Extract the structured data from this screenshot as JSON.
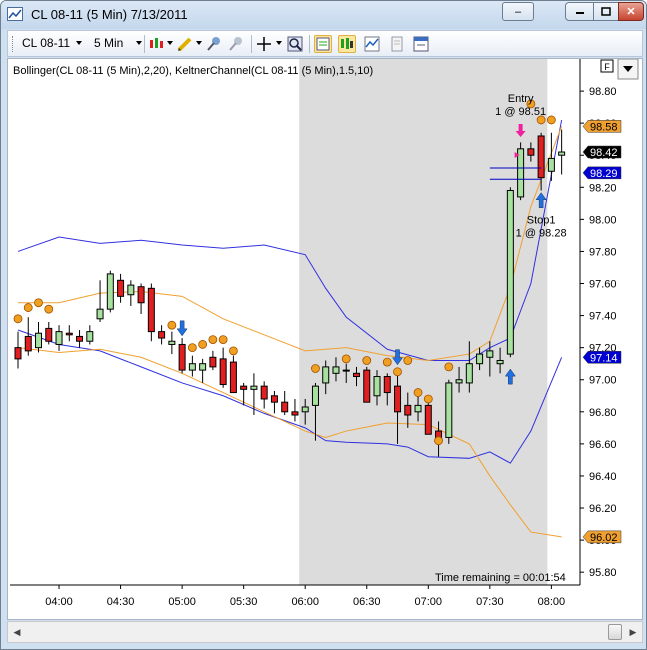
{
  "window": {
    "title": "CL 08-11 (5 Min)  7/13/2011",
    "buttons": {
      "minimize": "–",
      "maximize": "□",
      "close": "✕"
    }
  },
  "toolbar": {
    "instrument": "CL 08-11",
    "interval": "5 Min",
    "icons": [
      "chart-style-icon",
      "pencil-icon",
      "pin-icon",
      "pin-disabled-icon",
      "crosshair-icon",
      "zoom-icon",
      "data-box-icon",
      "chart-trader-icon",
      "indicators-icon",
      "strategies-icon",
      "properties-icon"
    ]
  },
  "chart": {
    "indicator_label": "Bollinger(CL 08-11 (5 Min),2,20), KeltnerChannel(CL 08-11 (5 Min),1.5,10)",
    "time_remaining": "Time remaining = 00:01:54",
    "corner_button": "F",
    "entry_label": "Entry",
    "entry_detail": "1 @ 98.51",
    "stop_label": "Stop1",
    "stop_detail": "1 @ 98.28",
    "highlight_start": "06:00",
    "highlight_end": "08:00"
  },
  "colors": {
    "up_candle": "#a8e0a0",
    "down_candle": "#e02020",
    "bollinger": "#3030e0",
    "keltner": "#f0a030",
    "session_shade": "#dcdcdc",
    "signal_dot": "#f0a020",
    "buy_arrow": "#2070e0",
    "entry_arrow": "#f020a0"
  },
  "chart_data": {
    "type": "candlestick",
    "x_axis_labels": [
      "04:00",
      "04:30",
      "05:00",
      "05:30",
      "06:00",
      "06:30",
      "07:00",
      "07:30",
      "08:00"
    ],
    "y_axis_labels": [
      "98.80",
      "98.60",
      "98.40",
      "98.20",
      "98.00",
      "97.80",
      "97.60",
      "97.40",
      "97.20",
      "97.00",
      "96.80",
      "96.60",
      "96.40",
      "96.20",
      "96.00",
      "95.80"
    ],
    "ylim": [
      95.72,
      99.0
    ],
    "xlim": [
      "03:40",
      "08:12"
    ],
    "price_markers": [
      {
        "label": "98.58",
        "value": 98.58,
        "color": "#f0a030",
        "text_color": "#000000"
      },
      {
        "label": "98.42",
        "value": 98.42,
        "color": "#000000",
        "text_color": "#ffffff"
      },
      {
        "label": "98.29",
        "value": 98.29,
        "color": "#0000d0",
        "text_color": "#ffffff"
      },
      {
        "label": "97.14",
        "value": 97.14,
        "color": "#0000d0",
        "text_color": "#ffffff"
      },
      {
        "label": "96.02",
        "value": 96.02,
        "color": "#f0a030",
        "text_color": "#000000"
      }
    ],
    "candles": [
      [
        "03:40",
        97.2,
        97.3,
        97.07,
        97.13
      ],
      [
        "03:45",
        97.27,
        97.39,
        97.15,
        97.18
      ],
      [
        "03:50",
        97.2,
        97.36,
        97.17,
        97.29
      ],
      [
        "03:55",
        97.32,
        97.36,
        97.22,
        97.24
      ],
      [
        "04:00",
        97.22,
        97.34,
        97.18,
        97.3
      ],
      [
        "04:05",
        97.29,
        97.34,
        97.24,
        97.28
      ],
      [
        "04:10",
        97.27,
        97.31,
        97.2,
        97.24
      ],
      [
        "04:15",
        97.24,
        97.34,
        97.22,
        97.3
      ],
      [
        "04:20",
        97.38,
        97.62,
        97.36,
        97.44
      ],
      [
        "04:25",
        97.44,
        97.68,
        97.42,
        97.66
      ],
      [
        "04:30",
        97.62,
        97.66,
        97.48,
        97.52
      ],
      [
        "04:35",
        97.53,
        97.62,
        97.46,
        97.59
      ],
      [
        "04:40",
        97.58,
        97.6,
        97.41,
        97.48
      ],
      [
        "04:45",
        97.57,
        97.6,
        97.24,
        97.3
      ],
      [
        "04:50",
        97.3,
        97.34,
        97.22,
        97.26
      ],
      [
        "04:55",
        97.22,
        97.3,
        97.16,
        97.24
      ],
      [
        "05:00",
        97.22,
        97.26,
        97.04,
        97.06
      ],
      [
        "05:05",
        97.06,
        97.15,
        97.02,
        97.1
      ],
      [
        "05:10",
        97.06,
        97.13,
        96.98,
        97.1
      ],
      [
        "05:15",
        97.14,
        97.18,
        97.06,
        97.08
      ],
      [
        "05:20",
        97.13,
        97.2,
        96.95,
        96.97
      ],
      [
        "05:25",
        97.11,
        97.15,
        96.92,
        96.92
      ],
      [
        "05:30",
        96.96,
        96.98,
        96.84,
        96.94
      ],
      [
        "05:35",
        96.94,
        97.04,
        96.78,
        96.96
      ],
      [
        "05:40",
        96.96,
        96.99,
        96.82,
        96.88
      ],
      [
        "05:45",
        96.9,
        96.93,
        96.79,
        96.86
      ],
      [
        "05:50",
        96.86,
        96.93,
        96.78,
        96.8
      ],
      [
        "05:55",
        96.8,
        96.88,
        96.74,
        96.78
      ],
      [
        "06:00",
        96.8,
        96.88,
        96.72,
        96.83
      ],
      [
        "06:05",
        96.84,
        96.98,
        96.62,
        96.96
      ],
      [
        "06:10",
        96.98,
        97.12,
        96.91,
        97.08
      ],
      [
        "06:15",
        97.04,
        97.14,
        96.99,
        97.08
      ],
      [
        "06:20",
        97.06,
        97.1,
        96.98,
        97.06
      ],
      [
        "06:25",
        97.04,
        97.08,
        96.96,
        97.02
      ],
      [
        "06:30",
        97.06,
        97.08,
        96.86,
        96.86
      ],
      [
        "06:35",
        96.9,
        97.06,
        96.84,
        97.02
      ],
      [
        "06:40",
        97.02,
        97.04,
        96.84,
        96.92
      ],
      [
        "06:45",
        96.96,
        97.04,
        96.6,
        96.8
      ],
      [
        "06:50",
        96.84,
        96.92,
        96.7,
        96.78
      ],
      [
        "06:55",
        96.8,
        96.9,
        96.74,
        96.84
      ],
      [
        "07:00",
        96.84,
        96.9,
        96.66,
        96.66
      ],
      [
        "07:05",
        96.68,
        96.74,
        96.52,
        96.62
      ],
      [
        "07:10",
        96.64,
        97.0,
        96.6,
        96.98
      ],
      [
        "07:15",
        96.98,
        97.08,
        96.92,
        97.0
      ],
      [
        "07:20",
        96.98,
        97.24,
        96.92,
        97.1
      ],
      [
        "07:25",
        97.1,
        97.2,
        97.06,
        97.16
      ],
      [
        "07:30",
        97.14,
        97.24,
        97.02,
        97.18
      ],
      [
        "07:35",
        97.1,
        97.2,
        97.04,
        97.12
      ],
      [
        "07:40",
        97.16,
        98.2,
        97.14,
        98.18
      ],
      [
        "07:45",
        98.14,
        98.48,
        98.12,
        98.44
      ],
      [
        "07:50",
        98.44,
        98.48,
        98.36,
        98.4
      ],
      [
        "07:55",
        98.52,
        98.54,
        98.18,
        98.26
      ],
      [
        "08:00",
        98.3,
        98.54,
        98.24,
        98.38
      ],
      [
        "08:05",
        98.4,
        98.56,
        98.28,
        98.42
      ]
    ],
    "bollinger_upper": [
      [
        "03:40",
        97.8
      ],
      [
        "04:00",
        97.89
      ],
      [
        "04:20",
        97.85
      ],
      [
        "04:40",
        97.87
      ],
      [
        "05:00",
        97.84
      ],
      [
        "05:20",
        97.82
      ],
      [
        "05:40",
        97.84
      ],
      [
        "06:00",
        97.78
      ],
      [
        "06:10",
        97.57
      ],
      [
        "06:20",
        97.39
      ],
      [
        "06:40",
        97.19
      ],
      [
        "07:00",
        97.12
      ],
      [
        "07:20",
        97.12
      ],
      [
        "07:30",
        97.2
      ],
      [
        "07:40",
        97.26
      ],
      [
        "07:50",
        97.6
      ],
      [
        "08:05",
        98.62
      ]
    ],
    "bollinger_lower": [
      [
        "03:40",
        97.31
      ],
      [
        "04:00",
        97.22
      ],
      [
        "04:20",
        97.18
      ],
      [
        "04:40",
        97.08
      ],
      [
        "05:00",
        96.98
      ],
      [
        "05:20",
        96.9
      ],
      [
        "05:40",
        96.79
      ],
      [
        "06:00",
        96.7
      ],
      [
        "06:10",
        96.62
      ],
      [
        "06:20",
        96.61
      ],
      [
        "06:40",
        96.6
      ],
      [
        "06:50",
        96.58
      ],
      [
        "07:00",
        96.52
      ],
      [
        "07:20",
        96.51
      ],
      [
        "07:30",
        96.55
      ],
      [
        "07:40",
        96.48
      ],
      [
        "07:50",
        96.68
      ],
      [
        "08:05",
        97.14
      ]
    ],
    "keltner_upper": [
      [
        "03:40",
        97.48
      ],
      [
        "04:00",
        97.48
      ],
      [
        "04:20",
        97.54
      ],
      [
        "04:40",
        97.55
      ],
      [
        "05:00",
        97.52
      ],
      [
        "05:20",
        97.38
      ],
      [
        "05:40",
        97.28
      ],
      [
        "06:00",
        97.18
      ],
      [
        "06:20",
        97.2
      ],
      [
        "06:40",
        97.15
      ],
      [
        "07:00",
        97.12
      ],
      [
        "07:20",
        97.16
      ],
      [
        "07:30",
        97.24
      ],
      [
        "07:40",
        97.58
      ],
      [
        "07:50",
        98.08
      ],
      [
        "08:05",
        98.58
      ]
    ],
    "keltner_lower": [
      [
        "03:40",
        97.2
      ],
      [
        "04:00",
        97.17
      ],
      [
        "04:20",
        97.19
      ],
      [
        "04:40",
        97.14
      ],
      [
        "05:00",
        97.04
      ],
      [
        "05:20",
        96.92
      ],
      [
        "05:40",
        96.8
      ],
      [
        "06:00",
        96.68
      ],
      [
        "06:10",
        96.64
      ],
      [
        "06:20",
        96.68
      ],
      [
        "06:40",
        96.73
      ],
      [
        "07:00",
        96.72
      ],
      [
        "07:20",
        96.6
      ],
      [
        "07:30",
        96.4
      ],
      [
        "07:40",
        96.22
      ],
      [
        "07:50",
        96.05
      ],
      [
        "08:05",
        96.02
      ]
    ],
    "signal_dots": [
      [
        "03:40",
        97.38
      ],
      [
        "03:45",
        97.45
      ],
      [
        "03:50",
        97.48
      ],
      [
        "03:55",
        97.44
      ],
      [
        "04:55",
        97.34
      ],
      [
        "05:05",
        97.2
      ],
      [
        "05:10",
        97.22
      ],
      [
        "05:15",
        97.25
      ],
      [
        "05:20",
        97.25
      ],
      [
        "05:25",
        97.18
      ],
      [
        "06:05",
        97.07
      ],
      [
        "06:20",
        97.13
      ],
      [
        "06:30",
        97.12
      ],
      [
        "06:40",
        97.11
      ],
      [
        "06:45",
        97.05
      ],
      [
        "06:50",
        97.12
      ],
      [
        "06:55",
        96.92
      ],
      [
        "07:00",
        96.88
      ],
      [
        "07:05",
        96.62
      ],
      [
        "07:10",
        97.08
      ],
      [
        "07:55",
        98.62
      ],
      [
        "08:00",
        98.62
      ],
      [
        "07:50",
        98.72
      ]
    ],
    "down_arrows": [
      [
        "05:00",
        97.28
      ],
      [
        "06:45",
        97.1
      ]
    ],
    "up_arrows": [
      [
        "07:40",
        97.06
      ],
      [
        "07:55",
        98.16
      ]
    ],
    "entry_arrow": [
      "07:45",
      98.52
    ],
    "entry_line": {
      "start": "07:30",
      "end": "07:55",
      "value": 98.32
    },
    "stop_line": {
      "start": "07:30",
      "end": "07:55",
      "value": 98.25
    }
  }
}
